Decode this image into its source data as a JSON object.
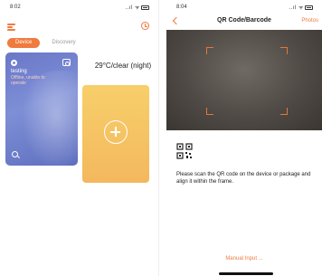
{
  "left_screen": {
    "status_time": "8:02",
    "status_icons": "..ıl ᯤ",
    "tabs": [
      {
        "label": "Device",
        "active": true
      },
      {
        "label": "Discovery",
        "active": false
      }
    ],
    "device_card": {
      "name": "testing",
      "status": "Offline, unable to operate"
    },
    "weather": "29°C/clear (night)"
  },
  "right_screen": {
    "status_time": "8:04",
    "status_icons": "..ıl ᯤ",
    "title": "QR Code/Barcode",
    "photos_label": "Photos",
    "hint": "Please scan the QR code on the device or package and align it within the frame.",
    "manual_input": "Manual Input ..."
  },
  "colors": {
    "accent": "#f07b3f",
    "card_blue": "#7e8fd6",
    "card_yellow": "#f5c163"
  }
}
